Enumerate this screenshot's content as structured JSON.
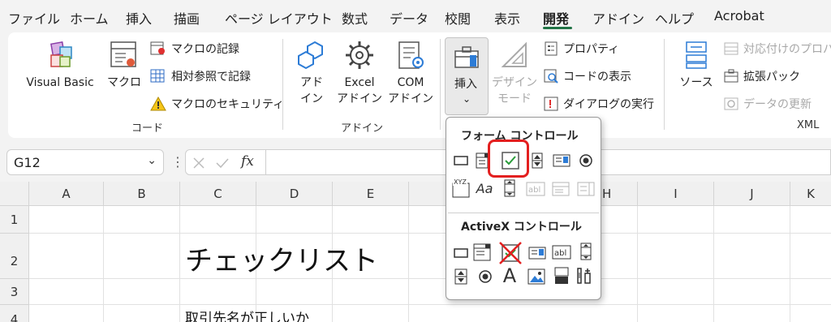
{
  "menu": {
    "tabs": [
      "ファイル",
      "ホーム",
      "挿入",
      "描画",
      "ページ レイアウト",
      "数式",
      "データ",
      "校閲",
      "表示",
      "開発",
      "アドイン",
      "ヘルプ",
      "Acrobat"
    ],
    "active_tab": "開発"
  },
  "ribbon": {
    "code": {
      "visual_basic": "Visual Basic",
      "macro": "マクロ",
      "record_macro": "マクロの記録",
      "relative_ref": "相対参照で記録",
      "macro_security": "マクロのセキュリティ",
      "label": "コード"
    },
    "addins": {
      "addin_l1": "アド",
      "addin_l2": "イン",
      "excel_l1": "Excel",
      "excel_l2": "アドイン",
      "com_l1": "COM",
      "com_l2": "アドイン",
      "label": "アドイン"
    },
    "controls": {
      "insert": "挿入",
      "design_l1": "デザイン",
      "design_l2": "モード",
      "properties": "プロパティ",
      "view_code": "コードの表示",
      "run_dialog": "ダイアログの実行"
    },
    "xml": {
      "source": "ソース",
      "map_props": "対応付けのプロパ",
      "ext_pack": "拡張パック",
      "refresh_data": "データの更新",
      "label": "XML"
    }
  },
  "formula_bar": {
    "name_box": "G12",
    "formula": ""
  },
  "grid": {
    "columns": [
      "A",
      "B",
      "C",
      "D",
      "E",
      "H",
      "I",
      "J",
      "K"
    ],
    "rows": [
      "1",
      "2",
      "3",
      "4"
    ],
    "c2": "チェックリスト",
    "c4": "取引先名が正しいか"
  },
  "dropdown": {
    "form_controls_title": "フォーム コントロール",
    "activex_title": "ActiveX コントロール",
    "xyz": "XYZ",
    "aa": "Aa",
    "abl": "abl",
    "big_a": "A"
  },
  "colors": {
    "accent": "#217346",
    "highlight": "#e31f1f"
  }
}
